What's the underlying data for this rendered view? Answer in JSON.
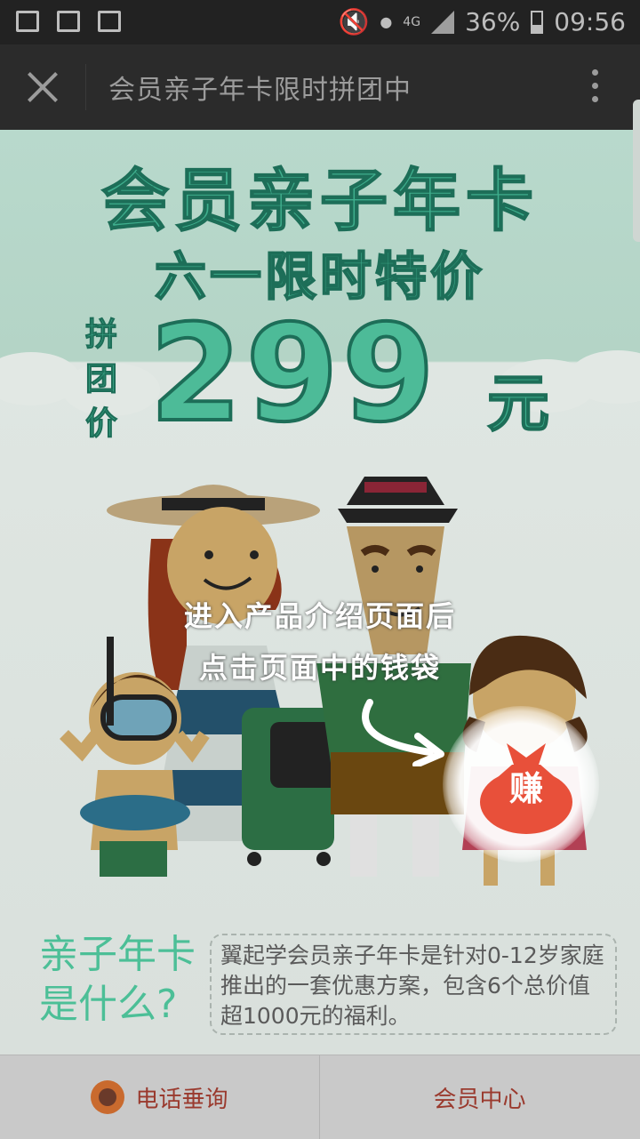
{
  "status_bar": {
    "network": "4G",
    "battery": "36%",
    "time": "09:56",
    "left_icons": [
      "device-icon",
      "image-icon",
      "mail-icon"
    ],
    "right_icons": [
      "mute-icon",
      "wifi-icon",
      "signal-icon",
      "battery-icon"
    ]
  },
  "title_bar": {
    "title": "会员亲子年卡限时拼团中",
    "close_icon": "close-icon",
    "more_icon": "more-icon"
  },
  "banner": {
    "headline": "会员亲子年卡",
    "subheadline": "六一限时特价",
    "price_prefix": [
      "拼",
      "团",
      "价"
    ],
    "price": "299",
    "price_unit": "元"
  },
  "overlay_tip": {
    "line1": "进入产品介绍页面后",
    "line2": "点击页面中的钱袋",
    "bag_label": "赚"
  },
  "info": {
    "title_line1": "亲子年卡",
    "title_line2": "是什么?",
    "description": "翼起学会员亲子年卡是针对0-12岁家庭推出的一套优惠方案，包含6个总价值超1000元的福利。"
  },
  "bottom_nav": {
    "left_label": "电话垂询",
    "right_label": "会员中心"
  },
  "colors": {
    "accent_green": "#3fae8d",
    "bag_red": "#e8503a",
    "nav_text": "#9a3a2e"
  }
}
